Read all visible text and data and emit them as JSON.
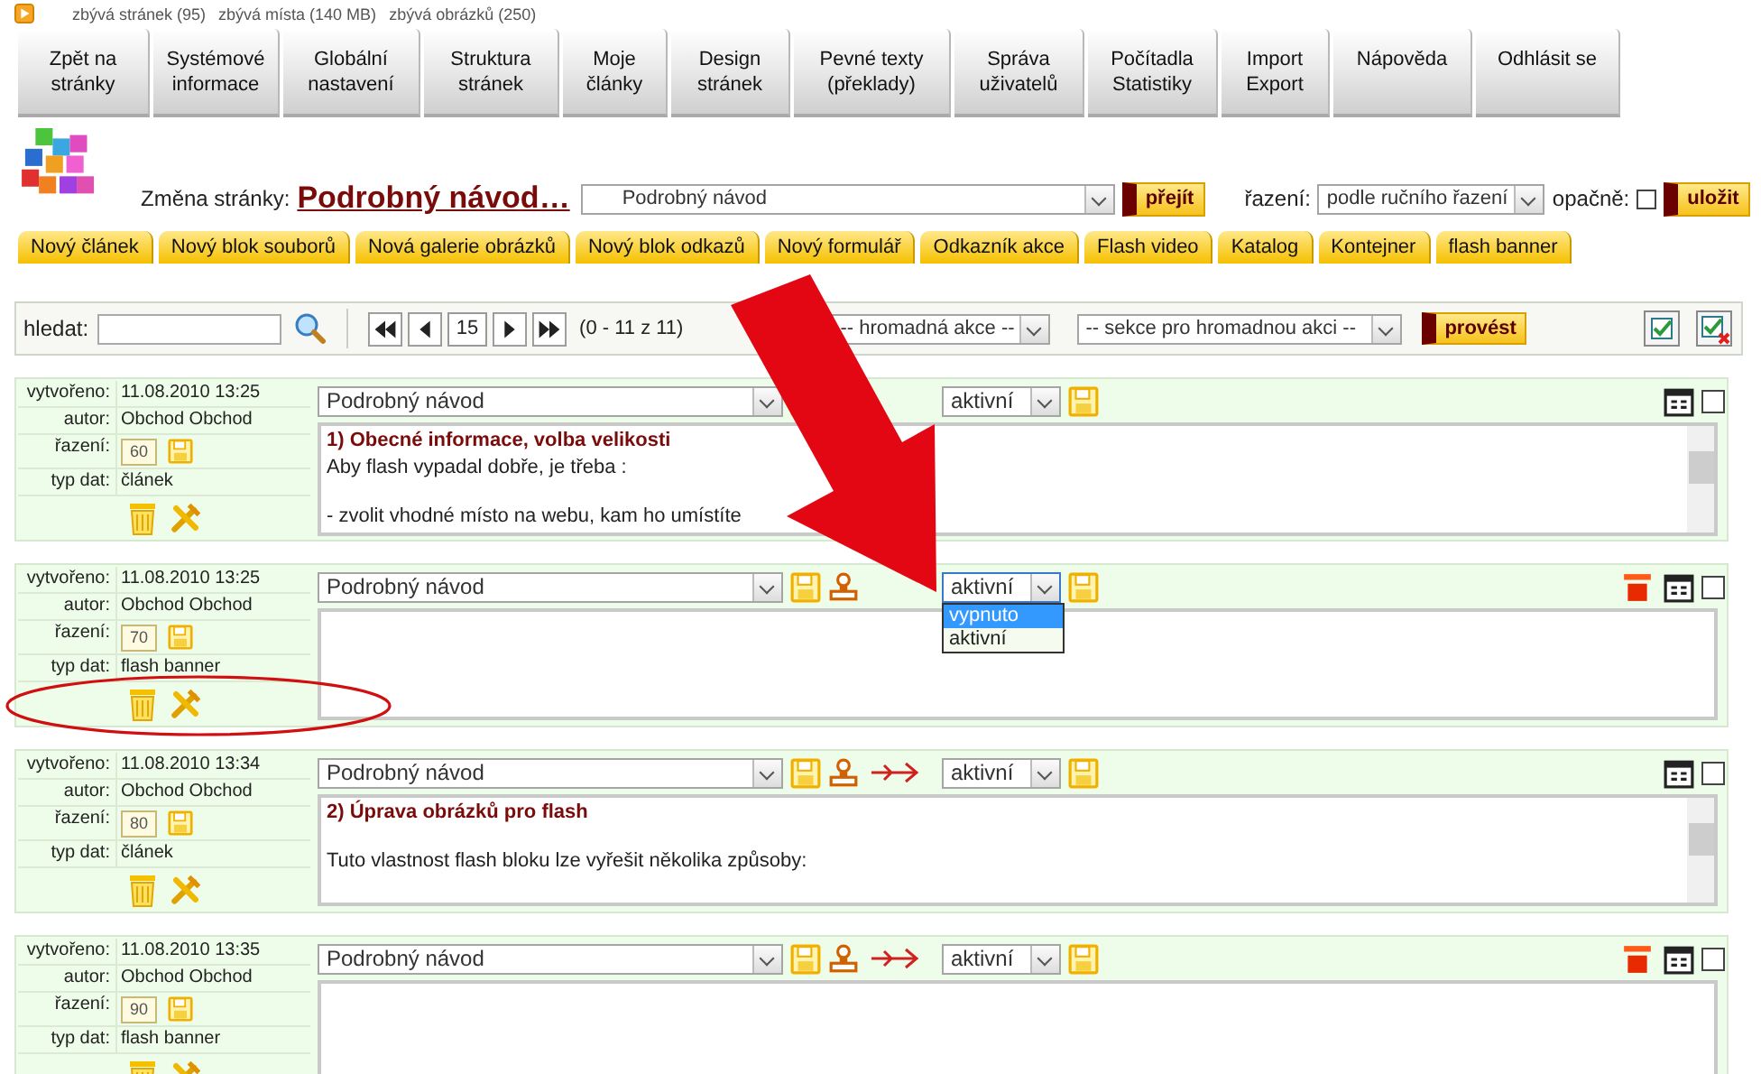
{
  "stats": [
    "zbývá stránek (95)",
    "zbývá místa (140 MB)",
    "zbývá obrázků (250)"
  ],
  "menu": [
    {
      "lines": [
        "Zpět na",
        "stránky"
      ]
    },
    {
      "lines": [
        "Systémové",
        "informace"
      ]
    },
    {
      "lines": [
        "Globální",
        "nastavení"
      ]
    },
    {
      "lines": [
        "Struktura",
        "stránek"
      ]
    },
    {
      "lines": [
        "Moje",
        "články"
      ]
    },
    {
      "lines": [
        "Design",
        "stránek"
      ]
    },
    {
      "lines": [
        "Pevné texty",
        "(překlady)"
      ]
    },
    {
      "lines": [
        "Správa",
        "uživatelů"
      ]
    },
    {
      "lines": [
        "Počítadla",
        "Statistiky"
      ]
    },
    {
      "lines": [
        "Import",
        "Export"
      ]
    },
    {
      "lines": [
        "Nápověda"
      ]
    },
    {
      "lines": [
        "Odhlásit se"
      ]
    }
  ],
  "page_change": {
    "label": "Změna stránky:",
    "title": "Podrobný návod…",
    "select": "Podrobný návod",
    "button": "přejít"
  },
  "sort": {
    "label": "řazení:",
    "select": "podle ručního řazení",
    "reverse_label": "opačně:",
    "reverse_checked": false,
    "button": "uložit"
  },
  "add_tabs": [
    "Nový článek",
    "Nový blok souborů",
    "Nová galerie obrázků",
    "Nový blok odkazů",
    "Nový formulář",
    "Odkazník akce",
    "Flash video",
    "Katalog",
    "Kontejner",
    "flash banner"
  ],
  "toolbar": {
    "search_label": "hledat:",
    "page": "15",
    "range": "(0 - 11 z 11)",
    "bulk_action": "-- hromadná akce --",
    "bulk_section": "-- sekce pro hromadnou akci --",
    "run": "provést"
  },
  "blocks": [
    {
      "kind": "article",
      "created_label": "vytvořeno:",
      "created": "11.08.2010 13:25",
      "author_label": "autor:",
      "author": "Obchod Obchod",
      "order_label": "řazení:",
      "order": "60",
      "type_label": "typ dat:",
      "type": "článek",
      "title": "Podrobný návod",
      "status": "aktivní",
      "transfer_icons": false,
      "checked": false,
      "content": [
        {
          "kind": "heading",
          "text": "1) Obecné informace, volba velikosti",
          "gap": false
        },
        {
          "kind": "text",
          "text": "Aby flash vypadal dobře, je třeba :",
          "gap": false
        },
        {
          "kind": "text",
          "text": "- zvolit vhodné místo na webu, kam ho umístíte",
          "gap": true
        }
      ]
    },
    {
      "kind": "banner",
      "created_label": "vytvořeno:",
      "created": "11.08.2010 13:25",
      "author_label": "autor:",
      "author": "Obchod Obchod",
      "order_label": "řazení:",
      "order": "70",
      "type_label": "typ dat:",
      "type": "flash banner",
      "title": "Podrobný návod",
      "status": "aktivní",
      "transfer_icons": true,
      "link_arrow": false,
      "checked": false,
      "status_options": [
        {
          "label": "vypnuto",
          "selected": true
        },
        {
          "label": "aktivní",
          "selected": false
        }
      ]
    },
    {
      "kind": "article",
      "created_label": "vytvořeno:",
      "created": "11.08.2010 13:34",
      "author_label": "autor:",
      "author": "Obchod Obchod",
      "order_label": "řazení:",
      "order": "80",
      "type_label": "typ dat:",
      "type": "článek",
      "title": "Podrobný návod",
      "status": "aktivní",
      "transfer_icons": true,
      "checked": false,
      "content": [
        {
          "kind": "heading",
          "text": "2) Úprava obrázků pro flash",
          "gap": false
        },
        {
          "kind": "text",
          "text": "Tuto vlastnost flash bloku lze vyřešit několika způsoby:",
          "gap": true
        }
      ]
    },
    {
      "kind": "banner",
      "created_label": "vytvořeno:",
      "created": "11.08.2010 13:35",
      "author_label": "autor:",
      "author": "Obchod Obchod",
      "order_label": "řazení:",
      "order": "90",
      "type_label": "typ dat:",
      "type": "flash banner",
      "title": "Podrobný návod",
      "status": "aktivní",
      "transfer_icons": true,
      "checked": false
    }
  ]
}
